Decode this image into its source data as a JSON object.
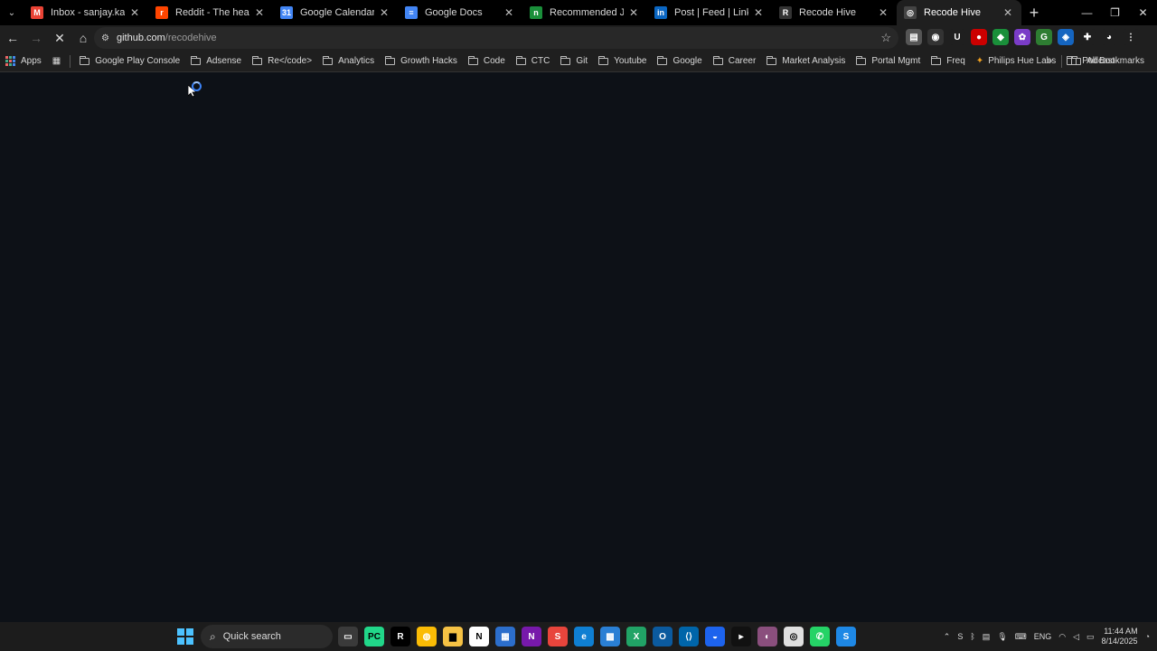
{
  "browser": {
    "tabs": [
      {
        "label": "Inbox - sanjay.kanakkot@",
        "icon": "gmail-icon",
        "color": "#ea4335",
        "glyph": "M"
      },
      {
        "label": "Reddit - The heart of the",
        "icon": "reddit-icon",
        "color": "#ff4500",
        "glyph": "r"
      },
      {
        "label": "Google Calendar - Week",
        "icon": "calendar-icon",
        "color": "#4285f4",
        "glyph": "31"
      },
      {
        "label": "Google Docs",
        "icon": "docs-icon",
        "color": "#4285f4",
        "glyph": "≡"
      },
      {
        "label": "Recommended Jobs For Y",
        "icon": "jobs-icon",
        "color": "#1a8f3a",
        "glyph": "n"
      },
      {
        "label": "Post | Feed | LinkedIn",
        "icon": "linkedin-icon",
        "color": "#0a66c2",
        "glyph": "in"
      },
      {
        "label": "Recode Hive",
        "icon": "recode-icon",
        "color": "#333333",
        "glyph": "R"
      },
      {
        "label": "Recode Hive",
        "icon": "github-icon",
        "color": "#444444",
        "glyph": "◎"
      }
    ],
    "active_tab_index": 7,
    "url": {
      "host": "github.com",
      "path": "/recodehive"
    }
  },
  "bookmarks": {
    "items": [
      {
        "label": "Apps",
        "type": "apps"
      },
      {
        "label": "",
        "type": "grid"
      },
      {
        "label": "Google Play Console",
        "type": "folder"
      },
      {
        "label": "Adsense",
        "type": "folder"
      },
      {
        "label": "Re</code>",
        "type": "folder"
      },
      {
        "label": "Analytics",
        "type": "folder"
      },
      {
        "label": "Growth Hacks",
        "type": "folder"
      },
      {
        "label": "Code",
        "type": "folder"
      },
      {
        "label": "CTC",
        "type": "folder"
      },
      {
        "label": "Git",
        "type": "folder"
      },
      {
        "label": "Youtube",
        "type": "folder"
      },
      {
        "label": "Google",
        "type": "folder"
      },
      {
        "label": "Career",
        "type": "folder"
      },
      {
        "label": "Market Analysis",
        "type": "folder"
      },
      {
        "label": "Portal Mgmt",
        "type": "folder"
      },
      {
        "label": "Freq",
        "type": "folder"
      },
      {
        "label": "Philips Hue Labs",
        "type": "link"
      },
      {
        "label": "Podcast",
        "type": "folder"
      }
    ],
    "all_bookmarks": "All Bookmarks"
  },
  "taskbar": {
    "search_label": "Quick search",
    "time": "11:44 AM",
    "date": "8/14/2025",
    "language": "ENG"
  }
}
